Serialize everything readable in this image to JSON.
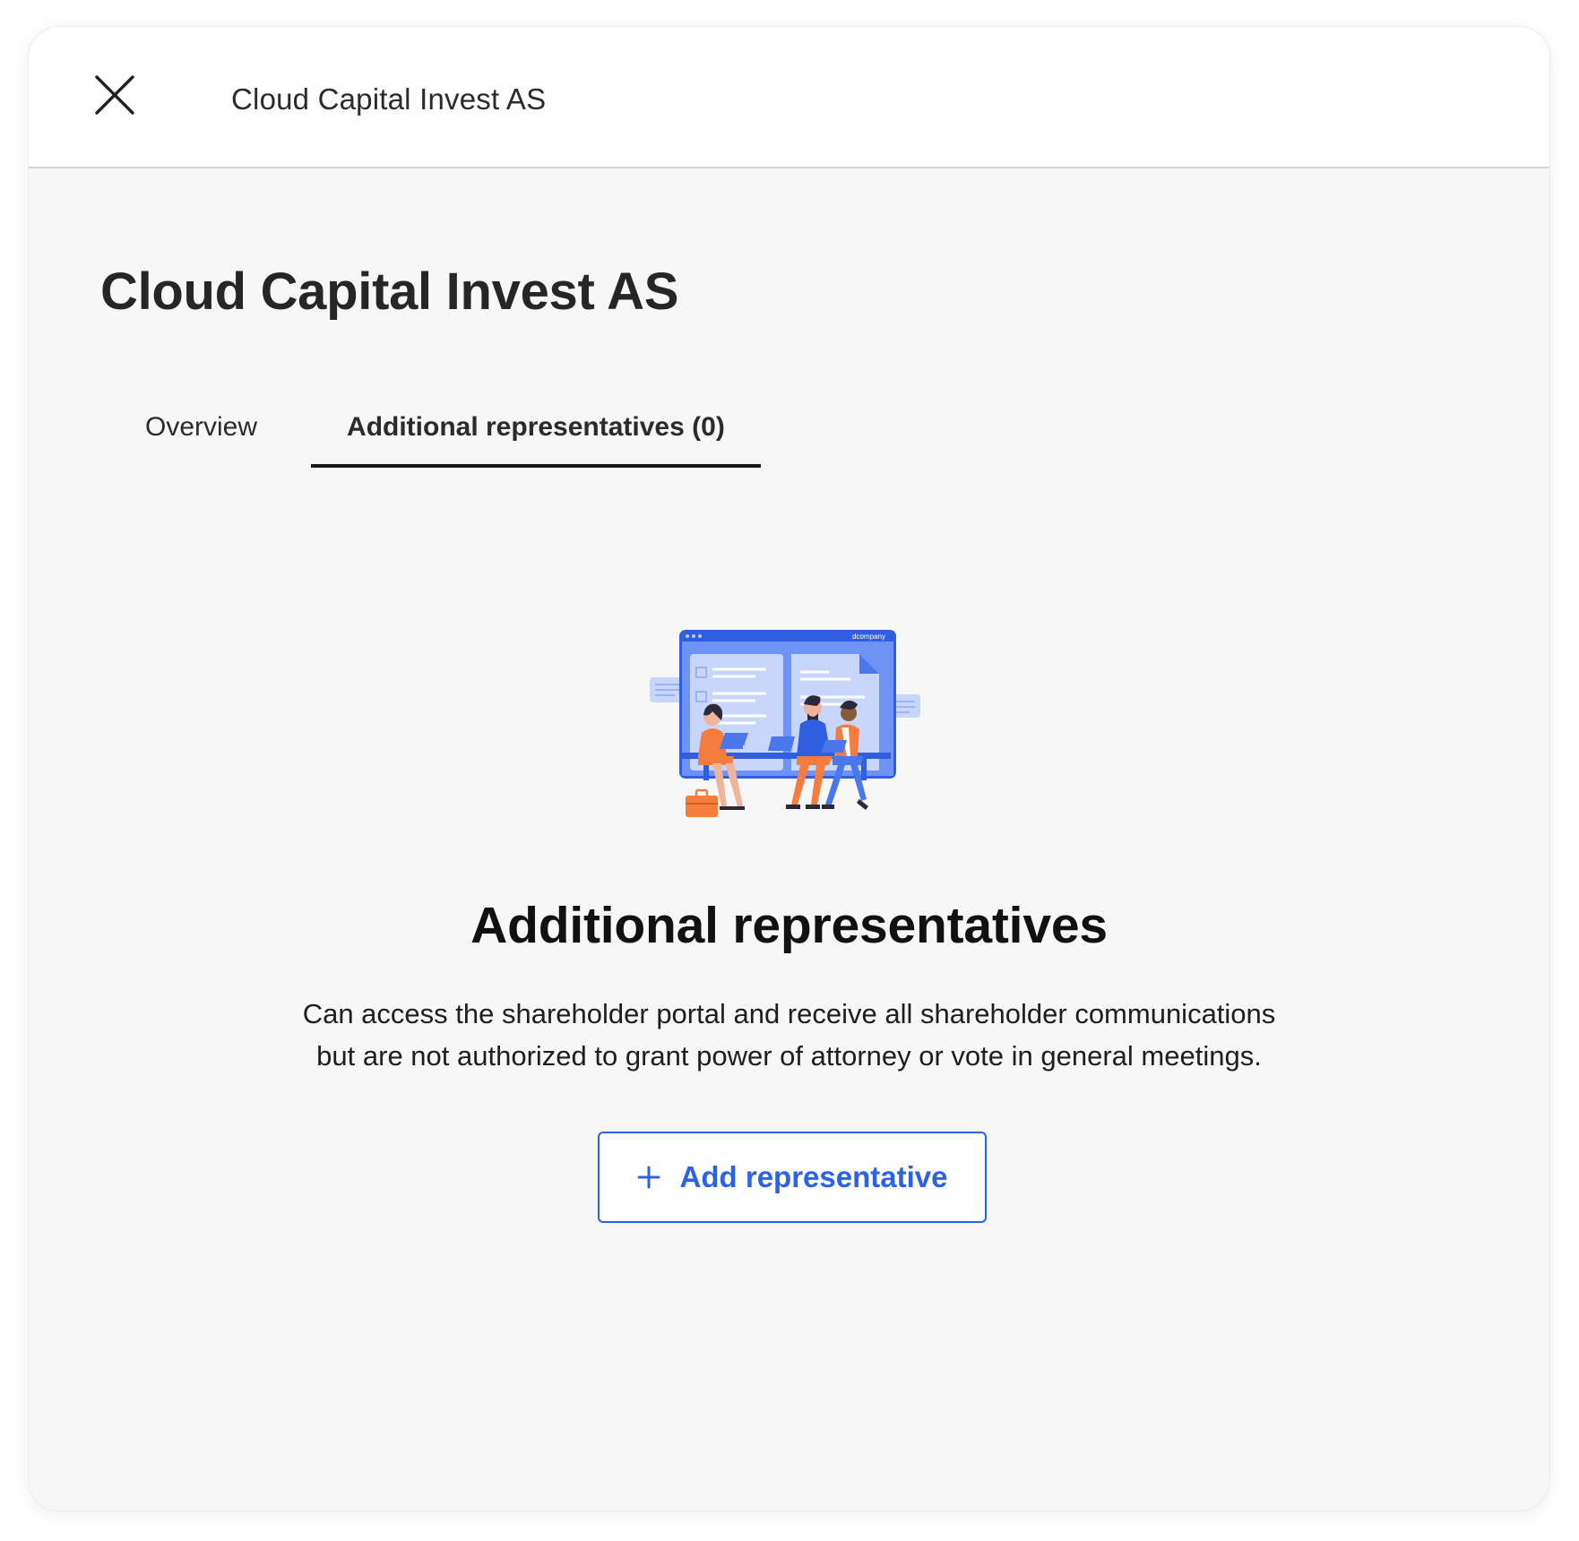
{
  "header": {
    "title": "Cloud Capital Invest AS",
    "close_icon": "close-icon"
  },
  "page": {
    "title": "Cloud Capital Invest AS"
  },
  "tabs": [
    {
      "label": "Overview",
      "active": false
    },
    {
      "label": "Additional representatives (0)",
      "active": true
    }
  ],
  "illustration": {
    "brand_label": "dcompany",
    "icon": "team-meeting-illustration"
  },
  "empty_state": {
    "title": "Additional representatives",
    "description_line1": "Can access the shareholder portal and receive all shareholder communications",
    "description_line2": "but are not authorized to grant power of attorney or vote in general meetings."
  },
  "actions": {
    "add_label": "Add representative",
    "add_icon": "plus-icon"
  },
  "colors": {
    "accent": "#2a63e6",
    "illustration_blue": "#2f5fe0",
    "illustration_orange": "#f47c3c",
    "background": "#f7f7f7"
  }
}
